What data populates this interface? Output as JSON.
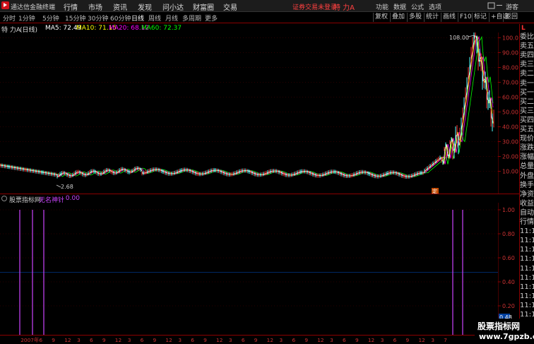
{
  "app": {
    "title": "通达信金融终端"
  },
  "menu": [
    "行情",
    "市场",
    "资讯",
    "发现",
    "问小达",
    "财富圈",
    "交易"
  ],
  "login_status": "证券交易未登录",
  "stock_title": "特 力A",
  "right_menu": [
    "功能",
    "数据",
    "公式",
    "选项",
    "游客"
  ],
  "timeframes": [
    "分时",
    "1分钟",
    "5分钟",
    "15分钟",
    "30分钟",
    "60分钟",
    "日线",
    "周线",
    "月线",
    "多周期",
    "更多"
  ],
  "active_timeframe": "日线",
  "toolbar_buttons": [
    "复权",
    "叠加",
    "多股",
    "统计",
    "画线",
    "F10",
    "标记",
    "+自选",
    "返回"
  ],
  "info": {
    "stock": "特 力A",
    "period": "(日线)",
    "ma": [
      {
        "label": "MA5: 72.49",
        "color": "#ffffff"
      },
      {
        "label": "MA10: 71.15",
        "color": "#ffff00"
      },
      {
        "label": "MA20: 68.12",
        "color": "#ff00ff"
      },
      {
        "label": "MA60: 72.37",
        "color": "#00ff00"
      }
    ]
  },
  "price_axis": [
    "100.0",
    "90.00",
    "80.00",
    "70.00",
    "60.00",
    "50.00",
    "40.00",
    "30.00",
    "20.00",
    "10.00"
  ],
  "annotations": {
    "high": "108.00",
    "low": "2.68",
    "marker": "定"
  },
  "side_panel": {
    "badge": "L",
    "items": [
      "委比",
      "卖五",
      "卖四",
      "卖三",
      "卖二",
      "卖一",
      "买一",
      "买二",
      "买三",
      "买四",
      "买五",
      "现价",
      "涨跌",
      "涨幅",
      "总量",
      "外盘",
      "换手",
      "净资",
      "收益",
      "自动",
      "行情",
      "11:1",
      "11:1",
      "11:1",
      "11:1",
      "11:1",
      "11:1",
      "11:1",
      "11:1",
      "11:1",
      "11:1",
      "11:1",
      "11:1"
    ]
  },
  "indicator": {
    "name": "股票指标网",
    "formula": "无名神针",
    "value": ": 0.00"
  },
  "ind_axis": [
    "1.00",
    "0.80",
    "0.60",
    "0.40",
    "0.20"
  ],
  "ind_value_badge": "0.48",
  "date_labels": [
    "2007年",
    "6",
    "9",
    "12",
    "3",
    "6",
    "9",
    "12",
    "3",
    "6",
    "9",
    "12",
    "3",
    "6",
    "9",
    "12",
    "3",
    "6",
    "9",
    "12",
    "3",
    "6",
    "9",
    "12",
    "3",
    "6",
    "9",
    "12",
    "3",
    "6",
    "9",
    "12",
    "3",
    "7"
  ],
  "watermark": {
    "line1": "股票指标网",
    "line2": "www.7gpzb.com"
  },
  "colors": {
    "up": "#ff3333",
    "down": "#54ffff",
    "ma5": "#ffffff",
    "ma10": "#ffff00",
    "ma20": "#ff00ff",
    "ma60": "#00ff00",
    "indicator": "#cc44ff",
    "grid": "#8b0000"
  }
}
